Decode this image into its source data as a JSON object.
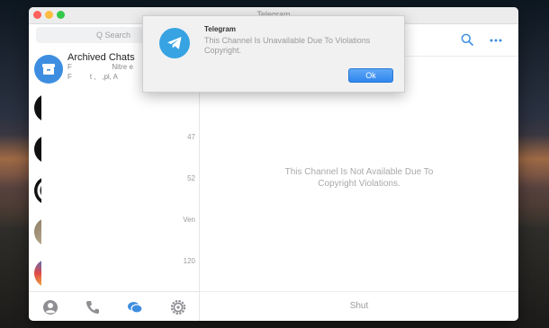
{
  "window": {
    "title": "Telegram"
  },
  "sidebar": {
    "search_placeholder": "Q Search",
    "archived": {
      "title": "Archived Chats",
      "subtitle": "F                    Nitre e\nF         t ,   ,pl, A"
    },
    "rows": [
      {
        "time": ""
      },
      {
        "time": "47"
      },
      {
        "time": "52"
      },
      {
        "time": "Ven"
      },
      {
        "time": "120"
      }
    ]
  },
  "tabs": [
    {
      "name": "contacts-icon"
    },
    {
      "name": "calls-icon"
    },
    {
      "name": "chats-icon"
    },
    {
      "name": "settings-icon"
    }
  ],
  "main": {
    "message_line1": "This Channel Is Not Available Due To",
    "message_line2": "Copyright Violations.",
    "shut_label": "Shut"
  },
  "alert": {
    "title": "Telegram",
    "message_line1": "This Channel Is Unavailable Due To Violations",
    "message_line2": "Copyright.",
    "ok_label": "Ok"
  },
  "colors": {
    "accent": "#3d8ee0",
    "ok_button": "#2f86ee"
  }
}
